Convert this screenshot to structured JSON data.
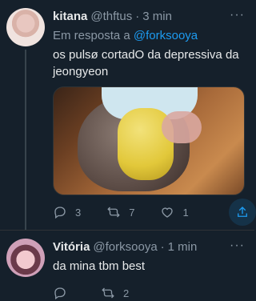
{
  "tweets": [
    {
      "name": "kitana",
      "handle": "@thftus",
      "time": "3 min",
      "reply_prefix": "Em resposta a",
      "reply_mention": "@forksooya",
      "text": "os pulsø cortadO da depressiva da jeongyeon",
      "counts": {
        "replies": "3",
        "retweets": "7",
        "likes": "1"
      }
    },
    {
      "name": "Vitória",
      "handle": "@forksooya",
      "time": "1 min",
      "text": "da mina tbm best",
      "counts": {
        "replies": "",
        "retweets": "2",
        "likes": ""
      }
    }
  ],
  "separator": "·",
  "more_glyph": "···",
  "colors": {
    "background": "#15202b",
    "text": "#e7e9ea",
    "muted": "#8b98a5",
    "accent": "#1d9bf0"
  },
  "icons": [
    "reply-icon",
    "retweet-icon",
    "like-icon",
    "share-icon",
    "more-icon"
  ]
}
